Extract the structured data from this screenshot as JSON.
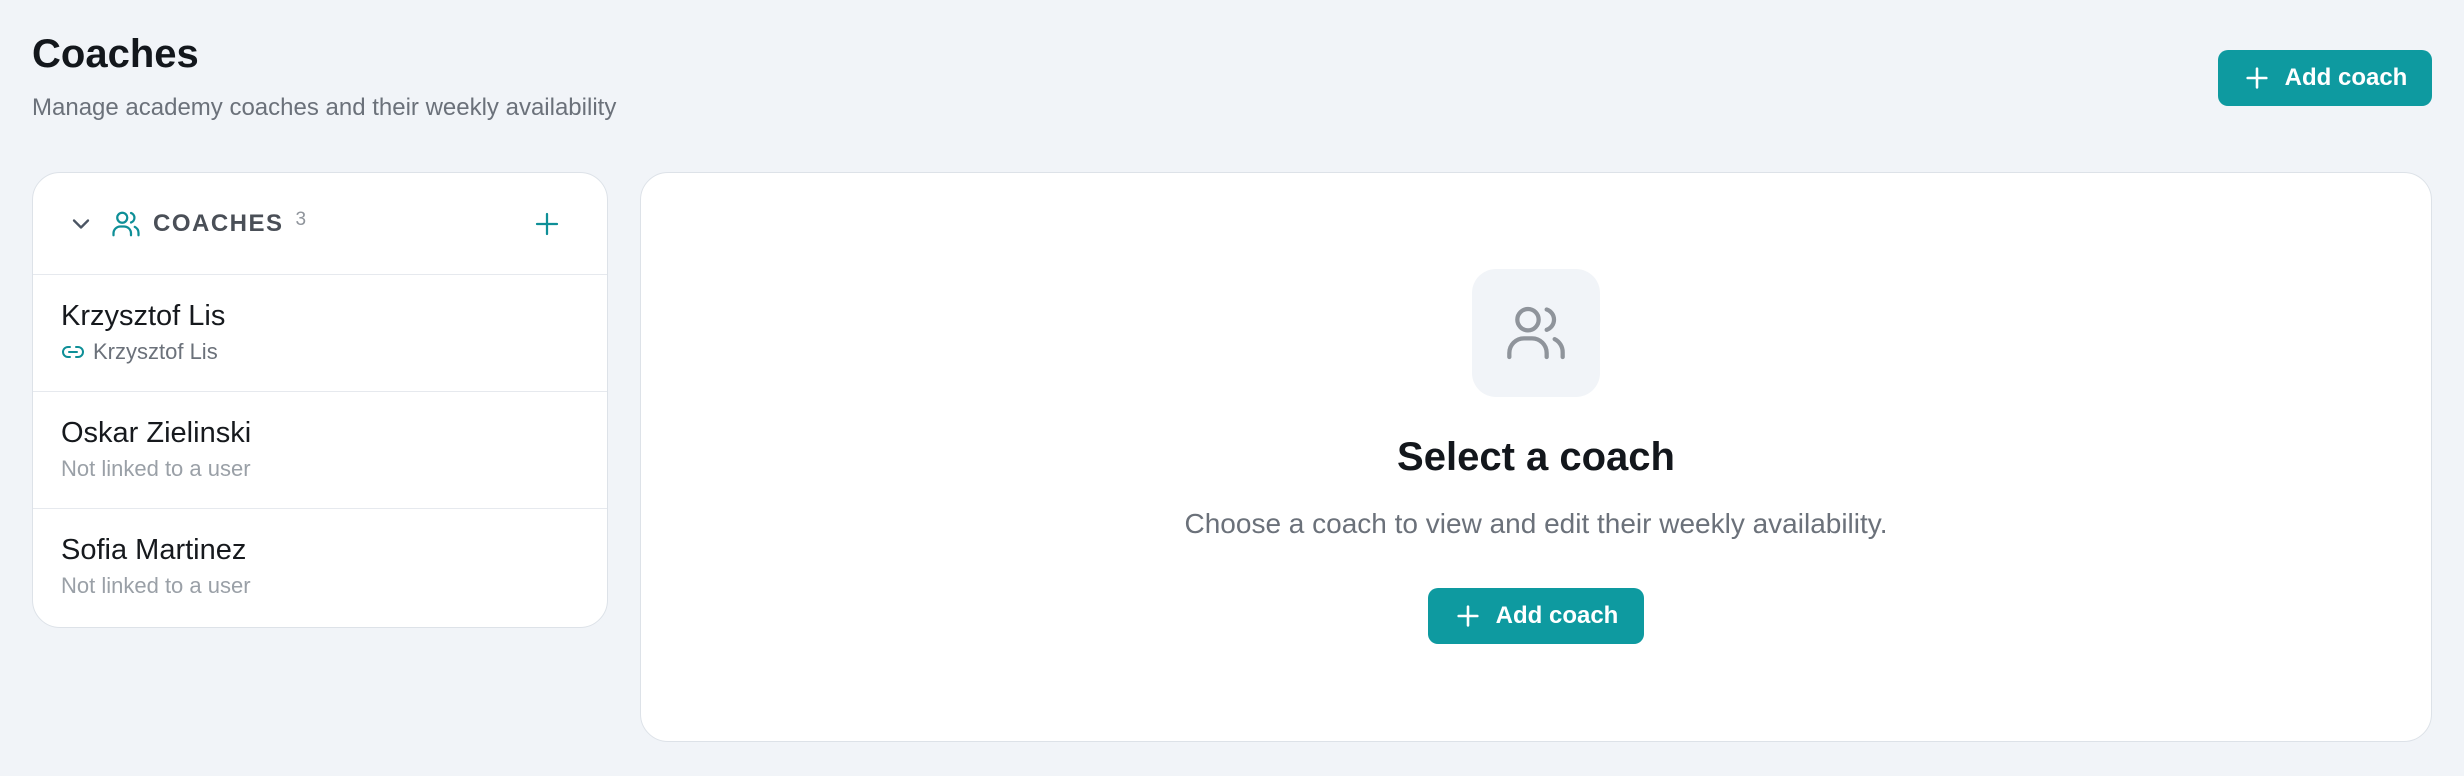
{
  "header": {
    "title": "Coaches",
    "subtitle": "Manage academy coaches and their weekly availability",
    "add_button_label": "Add coach"
  },
  "coach_list": {
    "title": "COACHES",
    "count": "3",
    "items": [
      {
        "name": "Krzysztof Lis",
        "sub": "Krzysztof Lis",
        "linked": true
      },
      {
        "name": "Oskar Zielinski",
        "sub": "Not linked to a user",
        "linked": false
      },
      {
        "name": "Sofia Martinez",
        "sub": "Not linked to a user",
        "linked": false
      }
    ]
  },
  "empty_state": {
    "title": "Select a coach",
    "description": "Choose a coach to view and edit their weekly availability.",
    "add_button_label": "Add coach"
  },
  "colors": {
    "accent": "#0e9aa0",
    "background": "#f1f4f8",
    "panel": "#ffffff"
  },
  "icons": {
    "collapse": "chevron-down-icon",
    "users": "users-icon",
    "add": "plus-icon",
    "link": "link-icon"
  }
}
